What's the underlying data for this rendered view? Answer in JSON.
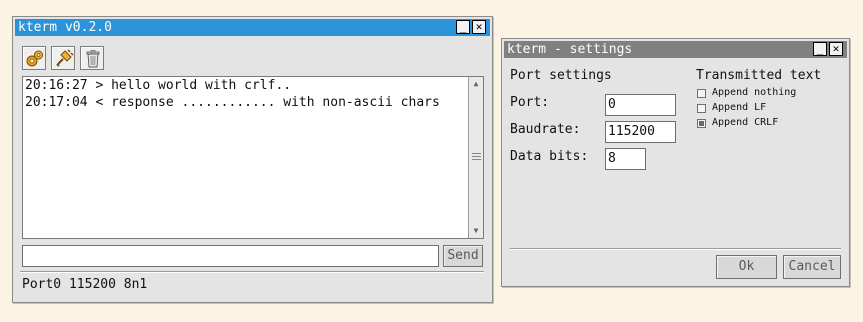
{
  "main_window": {
    "title": "kterm v0.2.0",
    "minimize_glyph": "_",
    "close_glyph": "✕",
    "toolbar": {
      "buttons": [
        {
          "icon": "settings-gears-icon"
        },
        {
          "icon": "connect-plug-icon"
        },
        {
          "icon": "trash-icon"
        }
      ]
    },
    "terminal_lines": [
      "20:16:27 > hello world with crlf..",
      "20:17:04 < response ............ with non-ascii chars"
    ],
    "scroll_up": "▲",
    "scroll_down": "▼",
    "send_input": {
      "value": "",
      "placeholder": ""
    },
    "send_label": "Send",
    "status": "Port0 115200 8n1"
  },
  "settings_window": {
    "title": "kterm - settings",
    "minimize_glyph": "_",
    "close_glyph": "✕",
    "port_section": "Port settings",
    "fields": [
      {
        "label": "Port:",
        "value": "0"
      },
      {
        "label": "Baudrate:",
        "value": "115200"
      },
      {
        "label": "Data bits:",
        "value": "8"
      }
    ],
    "tx_section": "Transmitted text",
    "options": [
      {
        "label": "Append nothing",
        "checked": false
      },
      {
        "label": "Append LF",
        "checked": false
      },
      {
        "label": "Append CRLF",
        "checked": true
      }
    ],
    "ok_label": "Ok",
    "cancel_label": "Cancel"
  },
  "colors": {
    "desktop": "#fbf3e3",
    "active_title": "#2a93d9",
    "inactive_title": "#808080",
    "window_bg": "#e4e4e4"
  }
}
